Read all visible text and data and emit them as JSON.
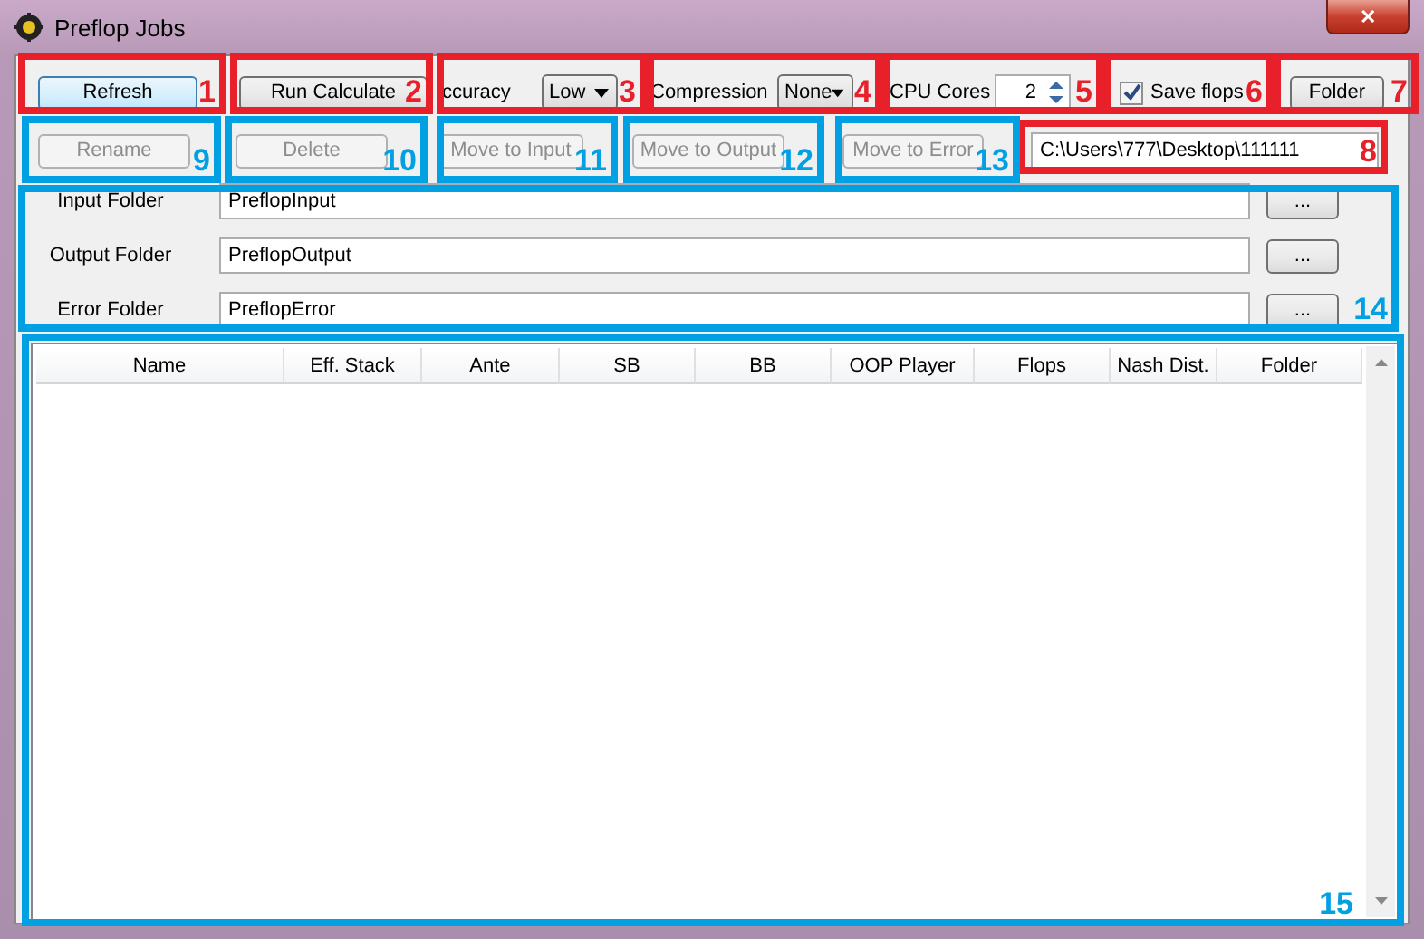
{
  "window": {
    "title": "Preflop Jobs",
    "close": "✕"
  },
  "toolbar": [
    {
      "kind": "button",
      "label": "Refresh",
      "default": true
    },
    {
      "kind": "button",
      "label": "Run Calculate",
      "default": false
    },
    {
      "kind": "label",
      "text": "ccuracy"
    },
    {
      "kind": "dropdown",
      "value": "Low"
    },
    {
      "kind": "label",
      "text": "Compression"
    },
    {
      "kind": "dropdown",
      "value": "None"
    },
    {
      "kind": "label",
      "text": "CPU Cores"
    },
    {
      "kind": "spinner",
      "value": "2"
    },
    {
      "kind": "checkbox",
      "label": "Save flops",
      "checked": true
    },
    {
      "kind": "button",
      "label": "Folder",
      "default": false
    }
  ],
  "actions": [
    {
      "label": "Rename",
      "disabled": true
    },
    {
      "label": "Delete",
      "disabled": true
    },
    {
      "label": "Move to Input",
      "disabled": true
    },
    {
      "label": "Move to Output",
      "disabled": true
    },
    {
      "label": "Move to Error",
      "disabled": true
    }
  ],
  "path_field": {
    "value": "C:\\Users\\777\\Desktop\\111111"
  },
  "folders": [
    {
      "label": "Input Folder",
      "value": "PreflopInput",
      "button": "..."
    },
    {
      "label": "Output Folder",
      "value": "PreflopOutput",
      "button": "..."
    },
    {
      "label": "Error Folder",
      "value": "PreflopError",
      "button": "..."
    }
  ],
  "table": {
    "columns": [
      "Name",
      "Eff. Stack",
      "Ante",
      "SB",
      "BB",
      "OOP Player",
      "Flops",
      "Nash Dist.",
      "Folder"
    ]
  },
  "annotations": [
    {
      "label": "1",
      "color": "#e8202a"
    },
    {
      "label": "2",
      "color": "#e8202a"
    },
    {
      "label": "3",
      "color": "#e8202a"
    },
    {
      "label": "4",
      "color": "#e8202a"
    },
    {
      "label": "5",
      "color": "#e8202a"
    },
    {
      "label": "6",
      "color": "#e8202a"
    },
    {
      "label": "7",
      "color": "#e8202a"
    },
    {
      "label": "8",
      "color": "#e8202a"
    },
    {
      "label": "9",
      "color": "#00a0e3"
    },
    {
      "label": "10",
      "color": "#00a0e3"
    },
    {
      "label": "11",
      "color": "#00a0e3"
    },
    {
      "label": "12",
      "color": "#00a0e3"
    },
    {
      "label": "13",
      "color": "#00a0e3"
    },
    {
      "label": "14",
      "color": "#00a0e3"
    },
    {
      "label": "15",
      "color": "#00a0e3"
    }
  ]
}
